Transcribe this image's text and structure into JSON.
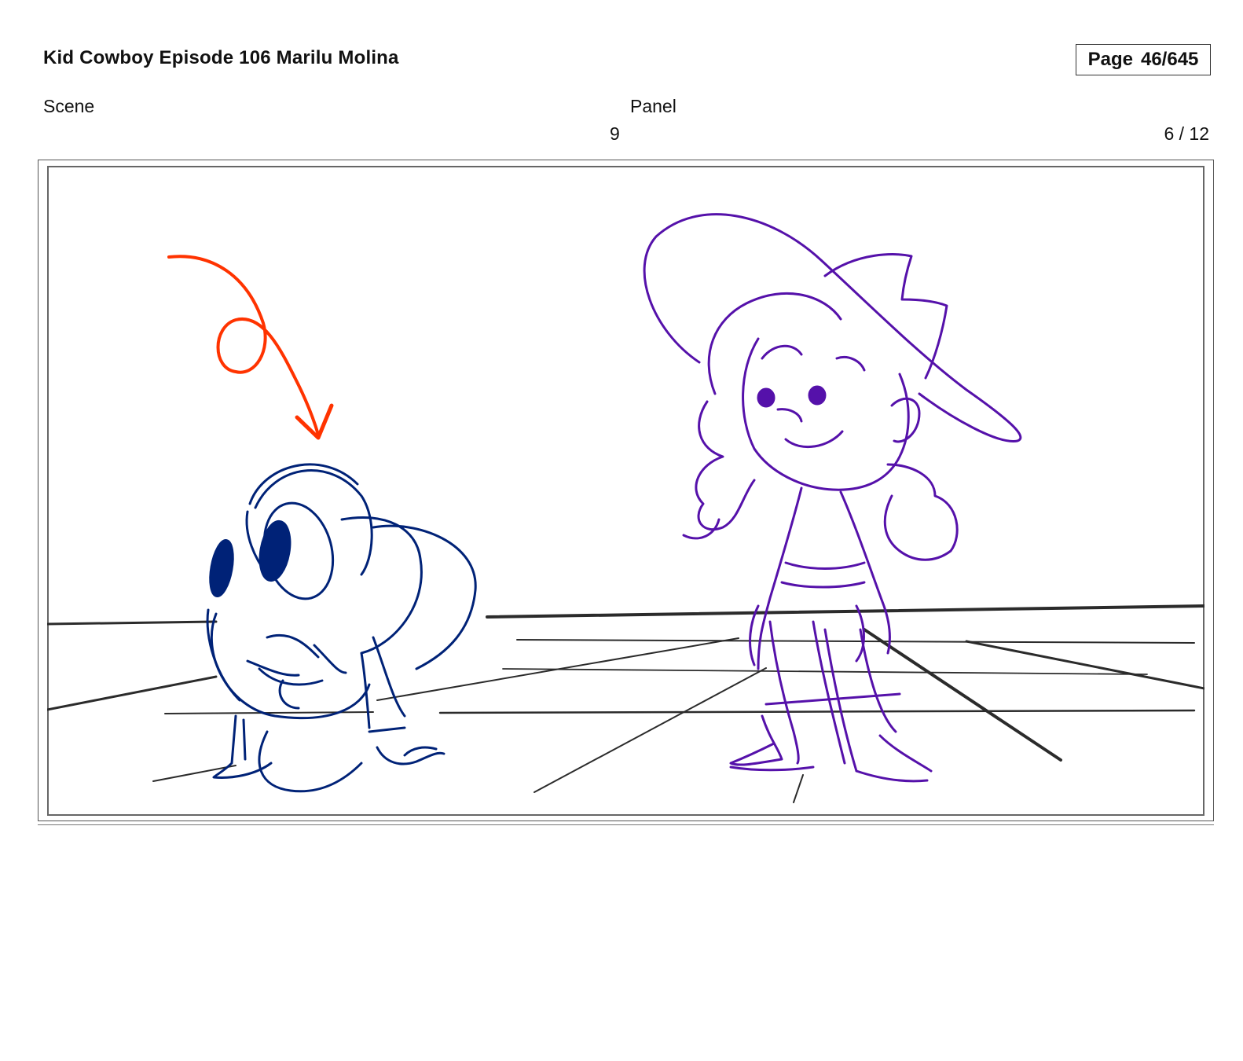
{
  "header": {
    "title": "Kid Cowboy Episode 106 Marilu Molina",
    "page_word": "Page",
    "page_number": "46/645"
  },
  "meta": {
    "scene_label": "Scene",
    "scene_value": "9",
    "panel_label": "Panel",
    "panel_value": "6 / 12"
  },
  "colors": {
    "floor_lines": "#2b2b2b",
    "arrow": "#ff3300",
    "mouse_sketch": "#002277",
    "girl_sketch": "#5511aa"
  }
}
